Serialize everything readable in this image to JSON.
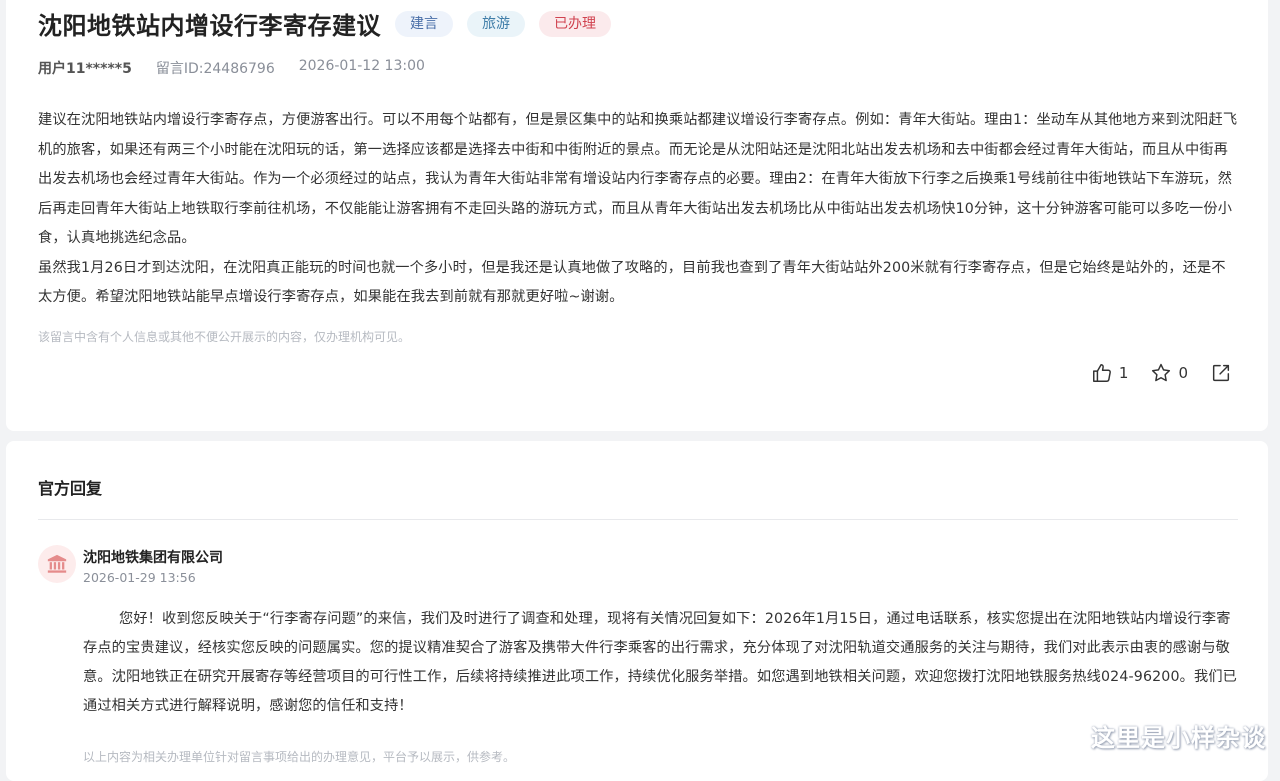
{
  "post": {
    "title": "沈阳地铁站内增设行李寄存建议",
    "tags": [
      {
        "label": "建言"
      },
      {
        "label": "旅游"
      },
      {
        "label": "已办理"
      }
    ],
    "user": "用户11*****5",
    "message_id": "留言ID:24486796",
    "datetime": "2026-01-12 13:00",
    "paragraphs": [
      "建议在沈阳地铁站内增设行李寄存点，方便游客出行。可以不用每个站都有，但是景区集中的站和换乘站都建议增设行李寄存点。例如：青年大街站。理由1：坐动车从其他地方来到沈阳赶飞机的旅客，如果还有两三个小时能在沈阳玩的话，第一选择应该都是选择去中街和中街附近的景点。而无论是从沈阳站还是沈阳北站出发去机场和去中街都会经过青年大街站，而且从中街再出发去机场也会经过青年大街站。作为一个必须经过的站点，我认为青年大街站非常有增设站内行李寄存点的必要。理由2：在青年大街放下行李之后换乘1号线前往中街地铁站下车游玩，然后再走回青年大街站上地铁取行李前往机场，不仅能能让游客拥有不走回头路的游玩方式，而且从青年大街站出发去机场比从中街站出发去机场快10分钟，这十分钟游客可能可以多吃一份小食，认真地挑选纪念品。",
      "虽然我1月26日才到达沈阳，在沈阳真正能玩的时间也就一个多小时，但是我还是认真地做了攻略的，目前我也查到了青年大街站站外200米就有行李寄存点，但是它始终是站外的，还是不太方便。希望沈阳地铁站能早点增设行李寄存点，如果能在我去到前就有那就更好啦~谢谢。"
    ],
    "privacy_note": "该留言中含有个人信息或其他不便公开展示的内容，仅办理机构可见。",
    "likes": "1",
    "favorites": "0",
    "icons": {
      "like": "thumbs-up-icon",
      "favorite": "star-icon",
      "share": "share-icon"
    }
  },
  "reply": {
    "section_title": "官方回复",
    "org_name": "沈阳地铁集团有限公司",
    "org_icon": "government-building-icon",
    "date": "2026-01-29 13:56",
    "body": "您好！收到您反映关于“行李寄存问题”的来信，我们及时进行了调查和处理，现将有关情况回复如下：2026年1月15日，通过电话联系，核实您提出在沈阳地铁站内增设行李寄存点的宝贵建议，经核实您反映的问题属实。您的提议精准契合了游客及携带大件行李乘客的出行需求，充分体现了对沈阳轨道交通服务的关注与期待，我们对此表示由衷的感谢与敬意。沈阳地铁正在研究开展寄存等经营项目的可行性工作，后续将持续推进此项工作，持续优化服务举措。如您遇到地铁相关问题，欢迎您拨打沈阳地铁服务热线024-96200。我们已通过相关方式进行解释说明，感谢您的信任和支持！",
    "note": "以上内容为相关办理单位针对留言事项给出的办理意见，平台予以展示，供参考。"
  },
  "watermark": "这里是小样杂谈",
  "colors": {
    "accent_red": "#d0424f",
    "tag_blue": "#4a6fa8"
  }
}
